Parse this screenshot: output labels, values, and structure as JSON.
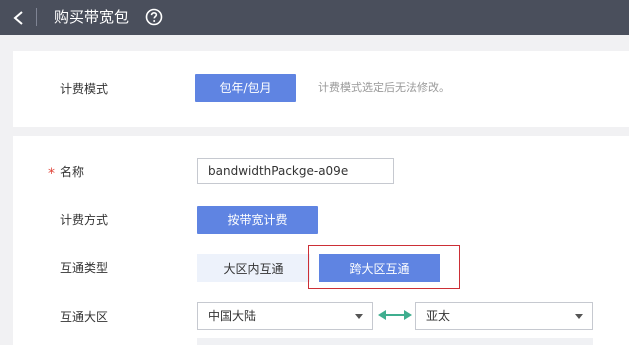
{
  "header": {
    "title": "购买带宽包"
  },
  "billing": {
    "mode_label": "计费模式",
    "mode_button": "包年/包月",
    "mode_hint": "计费模式选定后无法修改。"
  },
  "form": {
    "required_mark": "*",
    "name_label": "名称",
    "name_value": "bandwidthPackge-a09e",
    "charge_label": "计费方式",
    "charge_button": "按带宽计费",
    "interconnect_label": "互通类型",
    "interconnect_options": [
      "大区内互通",
      "跨大区互通"
    ],
    "interconnect_selected": "跨大区互通",
    "region_label": "互通大区",
    "region_from": "中国大陆",
    "region_to": "亚太"
  },
  "colors": {
    "primary": "#5f84e2",
    "topbar": "#4a4f5c",
    "highlight": "#cc2f36",
    "swap_arrow": "#3fae8f"
  },
  "icons": {
    "back": "chevron-left-icon",
    "help": "question-circle-icon",
    "swap": "double-arrow-icon",
    "caret": "caret-down-icon"
  }
}
